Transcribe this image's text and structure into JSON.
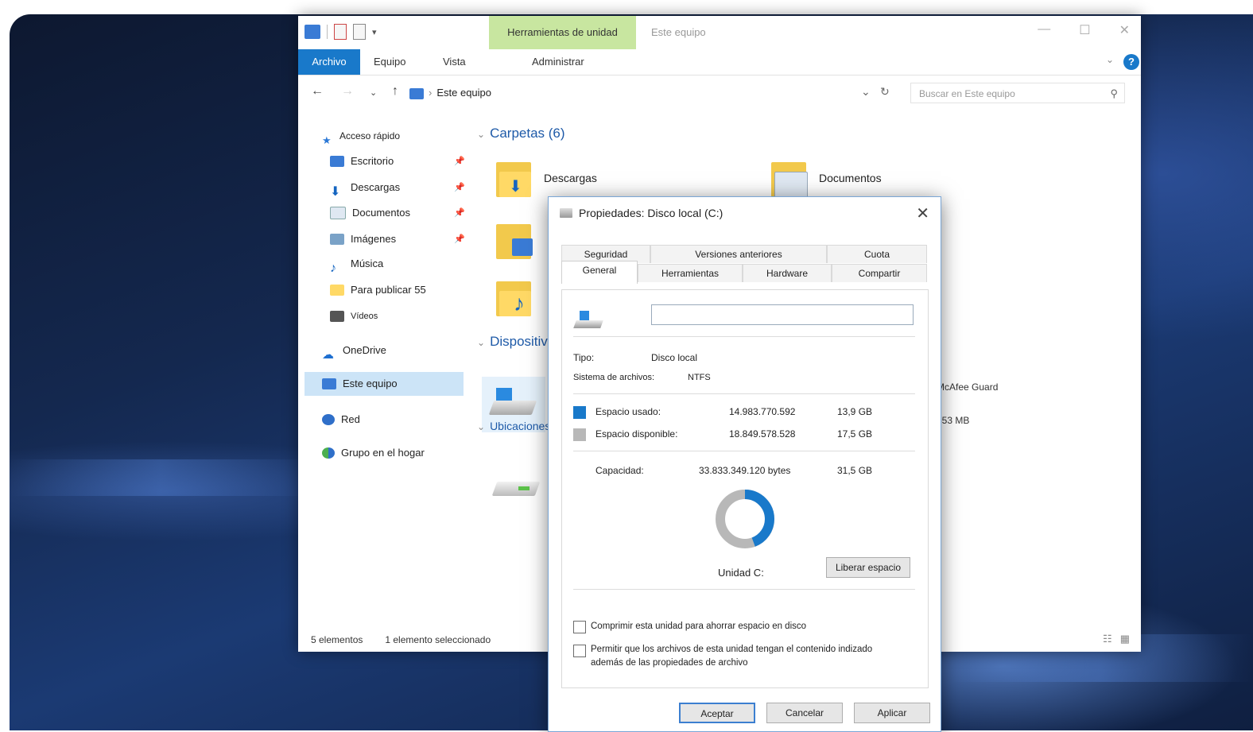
{
  "explorer": {
    "context_tab": "Herramientas de unidad",
    "window_title": "Este equipo",
    "ribbon_tabs": [
      "Archivo",
      "Equipo",
      "Vista",
      "Administrar"
    ],
    "address": "Este equipo",
    "search_placeholder": "Buscar en Este equipo",
    "nav_items": [
      {
        "label": "Acceso rápido",
        "icon": "star-icon"
      },
      {
        "label": "Escritorio",
        "icon": "desktop-icon"
      },
      {
        "label": "Descargas",
        "icon": "download-icon"
      },
      {
        "label": "Documentos",
        "icon": "documents-icon"
      },
      {
        "label": "Imágenes",
        "icon": "pictures-icon"
      },
      {
        "label": "Música",
        "icon": "music-icon"
      },
      {
        "label": "Para publicar 55",
        "icon": "folder-icon"
      },
      {
        "label": "Vídeos",
        "icon": "videos-icon"
      },
      {
        "label": "OneDrive",
        "icon": "cloud-icon"
      },
      {
        "label": "Este equipo",
        "icon": "computer-icon"
      },
      {
        "label": "Red",
        "icon": "network-icon"
      },
      {
        "label": "Grupo en el hogar",
        "icon": "homegroup-icon"
      }
    ],
    "group_folders": "Carpetas (6)",
    "group_devices": "Dispositivos y unidades",
    "group_locations": "Ubicaciones de red",
    "folders": [
      "Descargas",
      "Documentos"
    ],
    "device_right_label": "McAfee Guard",
    "device_right_size": "553 MB",
    "status_items": "5 elementos",
    "status_selected": "1 elemento seleccionado"
  },
  "dialog": {
    "title": "Propiedades: Disco local (C:)",
    "tabs_top": [
      "Seguridad",
      "Versiones anteriores",
      "Cuota"
    ],
    "tabs_bottom": [
      "General",
      "Herramientas",
      "Hardware",
      "Compartir"
    ],
    "name_value": "",
    "type_label": "Tipo:",
    "type_value": "Disco local",
    "fs_label": "Sistema de archivos:",
    "fs_value": "NTFS",
    "used_label": "Espacio usado:",
    "used_bytes": "14.983.770.592",
    "used_gb": "13,9 GB",
    "free_label": "Espacio disponible:",
    "free_bytes": "18.849.578.528",
    "free_gb": "17,5 GB",
    "capacity_label": "Capacidad:",
    "capacity_bytes": "33.833.349.120 bytes",
    "capacity_gb": "31,5 GB",
    "used_fraction": 0.443,
    "drive_caption": "Unidad C:",
    "cleanup_button": "Liberar espacio",
    "compress_label": "Comprimir esta unidad para ahorrar espacio en disco",
    "index_label": "Permitir que los archivos de esta unidad tengan el contenido indizado además de las propiedades de archivo",
    "ok": "Aceptar",
    "cancel": "Cancelar",
    "apply": "Aplicar",
    "colors": {
      "used": "#1979ca",
      "free": "#b8b8b8"
    }
  }
}
